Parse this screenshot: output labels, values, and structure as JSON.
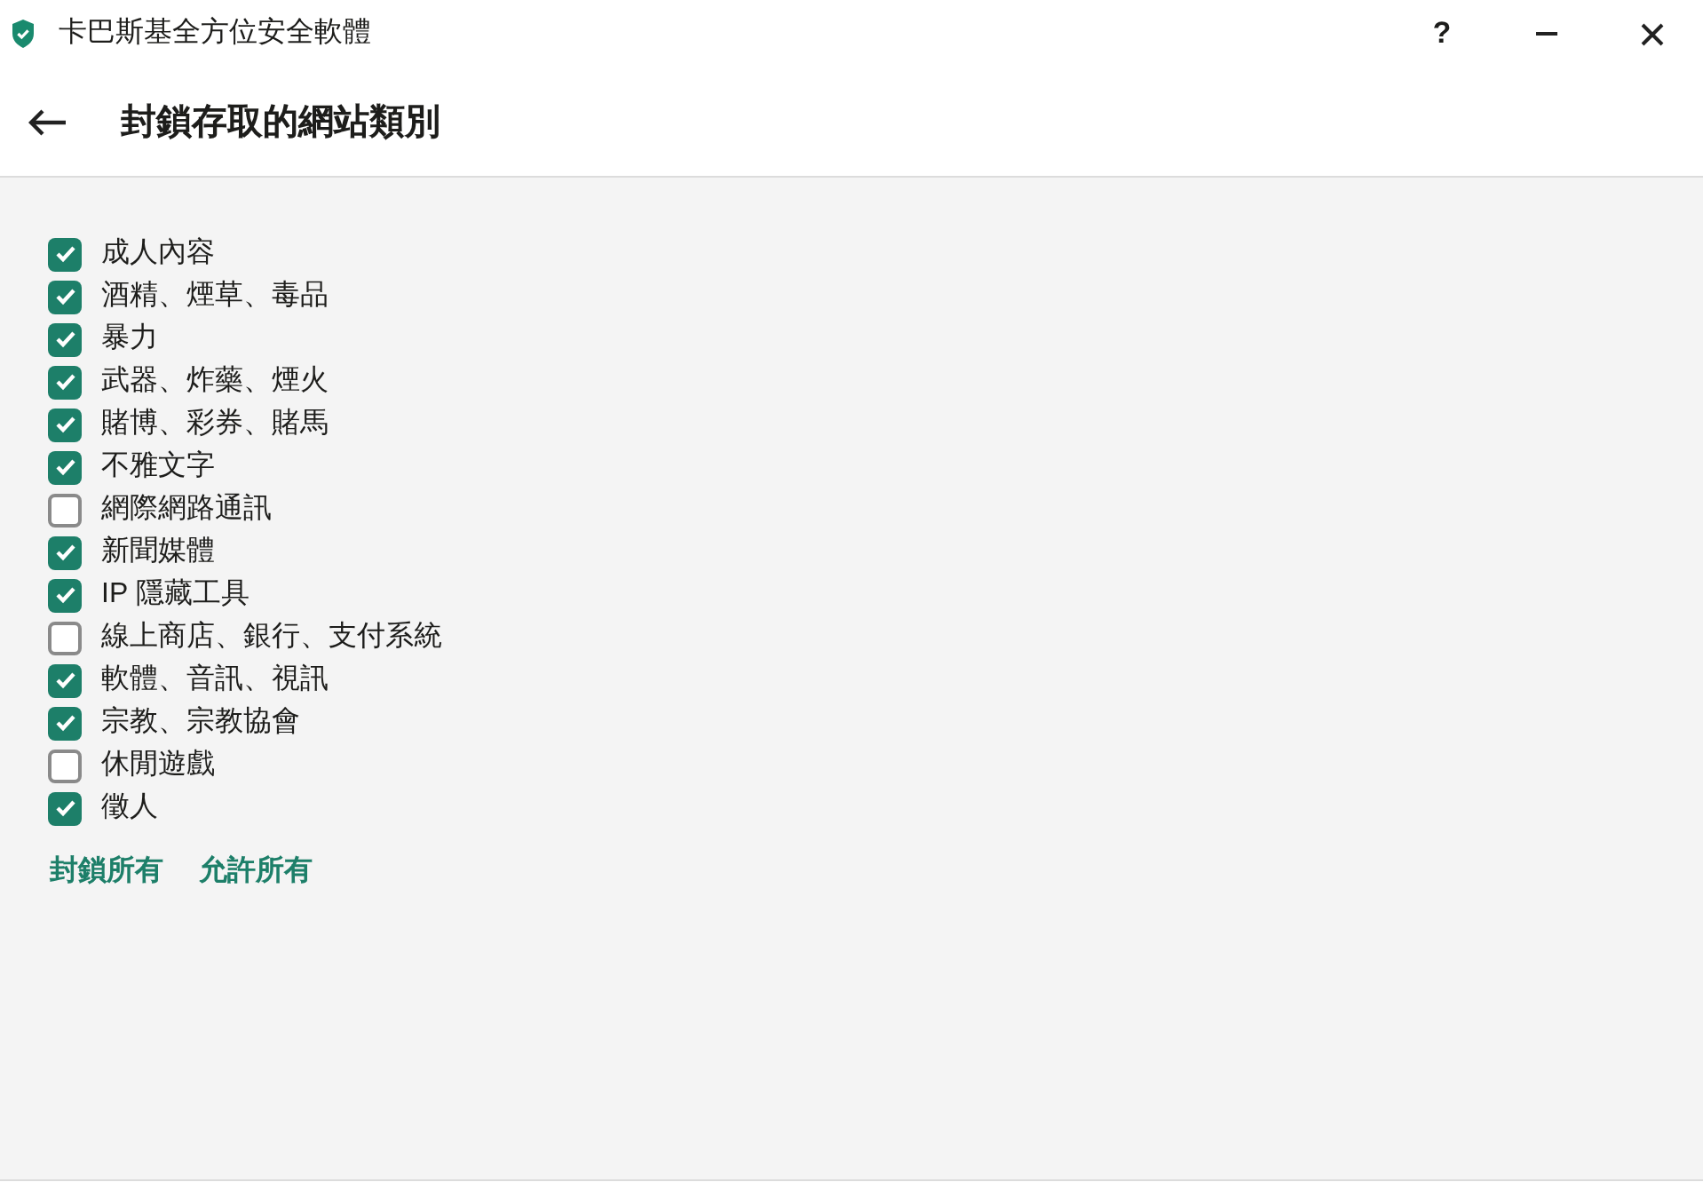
{
  "window": {
    "title": "卡巴斯基全方位安全軟體",
    "help": "?"
  },
  "header": {
    "title": "封鎖存取的網站類別"
  },
  "categories": [
    {
      "label": "成人內容",
      "checked": true
    },
    {
      "label": "酒精、煙草、毒品",
      "checked": true
    },
    {
      "label": "暴力",
      "checked": true
    },
    {
      "label": "武器、炸藥、煙火",
      "checked": true
    },
    {
      "label": "賭博、彩券、賭馬",
      "checked": true
    },
    {
      "label": "不雅文字",
      "checked": true
    },
    {
      "label": "網際網路通訊",
      "checked": false
    },
    {
      "label": "新聞媒體",
      "checked": true
    },
    {
      "label": "IP 隱藏工具",
      "checked": true
    },
    {
      "label": "線上商店、銀行、支付系統",
      "checked": false
    },
    {
      "label": "軟體、音訊、視訊",
      "checked": true
    },
    {
      "label": "宗教、宗教協會",
      "checked": true
    },
    {
      "label": "休閒遊戲",
      "checked": false
    },
    {
      "label": "徵人",
      "checked": true
    }
  ],
  "links": [
    "封鎖所有",
    "允許所有"
  ]
}
